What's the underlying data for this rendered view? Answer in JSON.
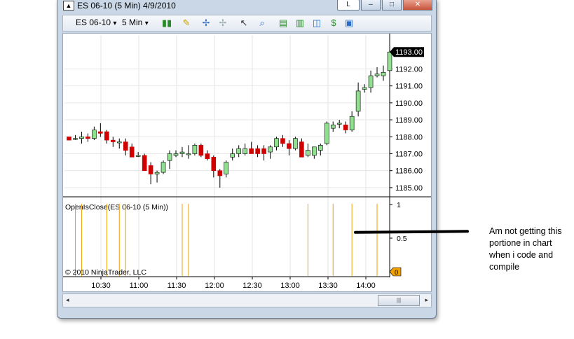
{
  "window": {
    "title": "ES 06-10 (5 Min)  4/9/2010",
    "help_label": "L",
    "minimize_label": "–",
    "maximize_label": "□",
    "close_label": "✕"
  },
  "toolbar": {
    "instrument": "ES 06-10",
    "interval": "5 Min",
    "dropdown_glyph": "▾"
  },
  "chart": {
    "copyright": "© 2010 NinjaTrader, LLC",
    "indicator_label": "OpenIsClose(ES 06-10 (5 Min))",
    "last_price_label": "1193.00",
    "indicator_marker": "0",
    "up_color": "#90e090",
    "down_color": "#d00000",
    "signal_color": "#f0a000",
    "grid_color": "#e6e6e6"
  },
  "scrollbar": {
    "left_arrow": "◂",
    "right_arrow": "▸",
    "thumb_grip": "|||"
  },
  "annotation": {
    "text": "Am not getting this portione in chart when i code and compile"
  },
  "chart_data": {
    "type": "candlestick",
    "price_axis": {
      "min": 1184.5,
      "max": 1194.0,
      "ticks": [
        1185,
        1186,
        1187,
        1188,
        1189,
        1190,
        1191,
        1192
      ]
    },
    "time_ticks": [
      "10:30",
      "11:00",
      "11:30",
      "12:00",
      "12:30",
      "13:00",
      "13:30",
      "14:00"
    ],
    "indicator_axis": {
      "ticks": [
        "1",
        "0.5"
      ]
    },
    "candles": [
      {
        "o": 1188.0,
        "h": 1188.0,
        "l": 1187.8,
        "c": 1187.8
      },
      {
        "o": 1187.9,
        "h": 1188.1,
        "l": 1187.8,
        "c": 1187.9
      },
      {
        "o": 1187.9,
        "h": 1188.3,
        "l": 1187.6,
        "c": 1188.0
      },
      {
        "o": 1188.0,
        "h": 1188.2,
        "l": 1187.7,
        "c": 1187.9
      },
      {
        "o": 1187.9,
        "h": 1188.6,
        "l": 1187.8,
        "c": 1188.4
      },
      {
        "o": 1188.3,
        "h": 1188.8,
        "l": 1188.0,
        "c": 1188.2
      },
      {
        "o": 1188.3,
        "h": 1188.4,
        "l": 1187.6,
        "c": 1187.8
      },
      {
        "o": 1187.8,
        "h": 1188.0,
        "l": 1187.4,
        "c": 1187.7
      },
      {
        "o": 1187.7,
        "h": 1187.9,
        "l": 1187.3,
        "c": 1187.7
      },
      {
        "o": 1187.7,
        "h": 1187.9,
        "l": 1186.9,
        "c": 1187.2
      },
      {
        "o": 1187.4,
        "h": 1187.6,
        "l": 1186.8,
        "c": 1186.8
      },
      {
        "o": 1186.9,
        "h": 1187.1,
        "l": 1186.8,
        "c": 1186.9
      },
      {
        "o": 1186.9,
        "h": 1187.0,
        "l": 1186.0,
        "c": 1186.0
      },
      {
        "o": 1186.3,
        "h": 1186.5,
        "l": 1185.2,
        "c": 1185.8
      },
      {
        "o": 1185.8,
        "h": 1186.0,
        "l": 1185.3,
        "c": 1185.9
      },
      {
        "o": 1185.9,
        "h": 1186.6,
        "l": 1185.8,
        "c": 1186.5
      },
      {
        "o": 1186.6,
        "h": 1187.2,
        "l": 1186.1,
        "c": 1187.0
      },
      {
        "o": 1186.9,
        "h": 1187.2,
        "l": 1186.8,
        "c": 1187.0
      },
      {
        "o": 1187.0,
        "h": 1187.4,
        "l": 1186.8,
        "c": 1187.1
      },
      {
        "o": 1187.0,
        "h": 1187.5,
        "l": 1186.7,
        "c": 1187.0
      },
      {
        "o": 1187.0,
        "h": 1187.6,
        "l": 1186.9,
        "c": 1187.5
      },
      {
        "o": 1187.5,
        "h": 1187.6,
        "l": 1186.8,
        "c": 1186.9
      },
      {
        "o": 1187.0,
        "h": 1187.2,
        "l": 1186.6,
        "c": 1186.7
      },
      {
        "o": 1186.8,
        "h": 1186.9,
        "l": 1185.6,
        "c": 1186.0
      },
      {
        "o": 1186.0,
        "h": 1186.1,
        "l": 1185.0,
        "c": 1185.7
      },
      {
        "o": 1185.8,
        "h": 1186.6,
        "l": 1185.6,
        "c": 1186.5
      },
      {
        "o": 1186.8,
        "h": 1187.3,
        "l": 1186.6,
        "c": 1187.0
      },
      {
        "o": 1187.0,
        "h": 1187.5,
        "l": 1186.8,
        "c": 1187.3
      },
      {
        "o": 1187.0,
        "h": 1187.6,
        "l": 1186.9,
        "c": 1187.3
      },
      {
        "o": 1187.3,
        "h": 1187.7,
        "l": 1187.0,
        "c": 1187.0
      },
      {
        "o": 1187.3,
        "h": 1187.5,
        "l": 1186.8,
        "c": 1187.0
      },
      {
        "o": 1187.3,
        "h": 1187.5,
        "l": 1186.6,
        "c": 1187.0
      },
      {
        "o": 1187.1,
        "h": 1187.5,
        "l": 1186.7,
        "c": 1187.4
      },
      {
        "o": 1187.4,
        "h": 1188.0,
        "l": 1187.2,
        "c": 1187.9
      },
      {
        "o": 1187.9,
        "h": 1188.1,
        "l": 1187.4,
        "c": 1187.6
      },
      {
        "o": 1187.6,
        "h": 1187.8,
        "l": 1186.9,
        "c": 1187.3
      },
      {
        "o": 1187.3,
        "h": 1188.0,
        "l": 1187.2,
        "c": 1187.9
      },
      {
        "o": 1187.7,
        "h": 1187.9,
        "l": 1186.8,
        "c": 1186.8
      },
      {
        "o": 1186.9,
        "h": 1187.6,
        "l": 1186.8,
        "c": 1187.2
      },
      {
        "o": 1186.9,
        "h": 1187.4,
        "l": 1186.7,
        "c": 1187.4
      },
      {
        "o": 1187.2,
        "h": 1187.6,
        "l": 1186.9,
        "c": 1187.5
      },
      {
        "o": 1187.6,
        "h": 1188.9,
        "l": 1187.5,
        "c": 1188.8
      },
      {
        "o": 1188.5,
        "h": 1188.9,
        "l": 1188.3,
        "c": 1188.7
      },
      {
        "o": 1188.8,
        "h": 1189.0,
        "l": 1188.5,
        "c": 1188.8
      },
      {
        "o": 1188.7,
        "h": 1188.9,
        "l": 1188.2,
        "c": 1188.4
      },
      {
        "o": 1188.4,
        "h": 1189.5,
        "l": 1188.3,
        "c": 1189.2
      },
      {
        "o": 1189.5,
        "h": 1191.2,
        "l": 1189.2,
        "c": 1190.7
      },
      {
        "o": 1190.8,
        "h": 1191.1,
        "l": 1190.6,
        "c": 1190.9
      },
      {
        "o": 1190.9,
        "h": 1191.9,
        "l": 1190.6,
        "c": 1191.6
      },
      {
        "o": 1191.6,
        "h": 1192.1,
        "l": 1191.5,
        "c": 1191.7
      },
      {
        "o": 1191.6,
        "h": 1192.2,
        "l": 1191.3,
        "c": 1191.8
      },
      {
        "o": 1191.9,
        "h": 1193.1,
        "l": 1191.8,
        "c": 1193.0
      }
    ],
    "signal_bar_indices": [
      1,
      2,
      6,
      8,
      9,
      18,
      19,
      38,
      42,
      45,
      49
    ]
  }
}
